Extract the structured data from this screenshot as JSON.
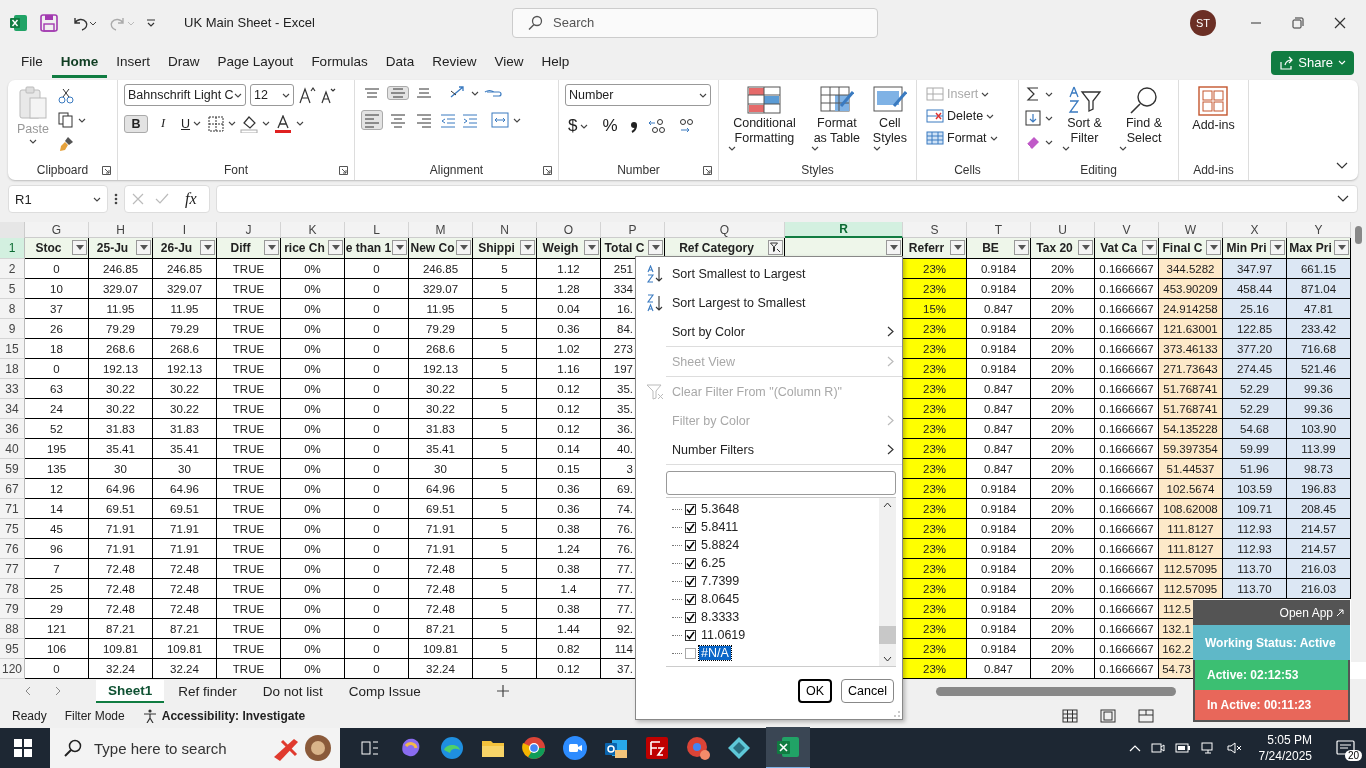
{
  "title_bar": {
    "document_title": "UK Main Sheet  -  Excel",
    "search": {
      "placeholder": "Search"
    },
    "avatar": "ST"
  },
  "menu_tabs": [
    {
      "label": "File",
      "selected": false
    },
    {
      "label": "Home",
      "selected": true
    },
    {
      "label": "Insert",
      "selected": false
    },
    {
      "label": "Draw",
      "selected": false
    },
    {
      "label": "Page Layout",
      "selected": false
    },
    {
      "label": "Formulas",
      "selected": false
    },
    {
      "label": "Data",
      "selected": false
    },
    {
      "label": "Review",
      "selected": false
    },
    {
      "label": "View",
      "selected": false
    },
    {
      "label": "Help",
      "selected": false
    }
  ],
  "share_button": "Share",
  "ribbon": {
    "clipboard": {
      "paste": "Paste",
      "label": "Clipboard"
    },
    "font": {
      "name": "Bahnschrift Light C",
      "size": "12",
      "bold": {
        "label": "B",
        "on": true
      },
      "italic": "I",
      "underline": "U",
      "label": "Font"
    },
    "alignment": {
      "vertical": [
        {
          "kind": "top",
          "on": false
        },
        {
          "kind": "middle",
          "on": true
        },
        {
          "kind": "bottom",
          "on": false
        }
      ],
      "horizontal": [
        {
          "kind": "left",
          "on": true
        },
        {
          "kind": "center",
          "on": false
        },
        {
          "kind": "right",
          "on": false
        }
      ],
      "label": "Alignment"
    },
    "number": {
      "format": "Number",
      "currency": "$",
      "percent": "%",
      "label": "Number"
    },
    "styles": {
      "buttons": [
        {
          "kind": "conditional",
          "label": "Conditional Formatting"
        },
        {
          "kind": "table",
          "label": "Format as Table"
        },
        {
          "kind": "cell",
          "label": "Cell Styles"
        }
      ],
      "label": "Styles"
    },
    "cells": {
      "buttons": [
        {
          "kind": "insert",
          "label": "Insert",
          "disabled": true
        },
        {
          "kind": "delete",
          "label": "Delete",
          "disabled": false
        },
        {
          "kind": "format",
          "label": "Format",
          "disabled": false
        }
      ],
      "label": "Cells"
    },
    "editing": {
      "buttons": [
        {
          "kind": "sort",
          "label": "Sort & Filter"
        },
        {
          "kind": "find",
          "label": "Find & Select"
        }
      ],
      "label": "Editing"
    },
    "addins": {
      "button": "Add-ins",
      "label": "Add-ins"
    }
  },
  "formula_bar": {
    "name_box": "R1",
    "fx": "fx"
  },
  "columns": [
    {
      "letter": "G",
      "selected": false
    },
    {
      "letter": "H",
      "selected": false
    },
    {
      "letter": "I",
      "selected": false
    },
    {
      "letter": "J",
      "selected": false
    },
    {
      "letter": "K",
      "selected": false
    },
    {
      "letter": "L",
      "selected": false
    },
    {
      "letter": "M",
      "selected": false
    },
    {
      "letter": "N",
      "selected": false
    },
    {
      "letter": "O",
      "selected": false
    },
    {
      "letter": "P",
      "selected": false
    },
    {
      "letter": "Q",
      "selected": false
    },
    {
      "letter": "R",
      "selected": true
    },
    {
      "letter": "S",
      "selected": false
    },
    {
      "letter": "T",
      "selected": false
    },
    {
      "letter": "U",
      "selected": false
    },
    {
      "letter": "V",
      "selected": false
    },
    {
      "letter": "W",
      "selected": false
    },
    {
      "letter": "X",
      "selected": false
    },
    {
      "letter": "Y",
      "selected": false
    }
  ],
  "header_row": {
    "number": "1",
    "cells": [
      {
        "label": "Stoc",
        "filter_active": false
      },
      {
        "label": "25-Ju",
        "filter_active": false
      },
      {
        "label": "26-Ju",
        "filter_active": false
      },
      {
        "label": "Diff",
        "filter_active": false
      },
      {
        "label": "rice Ch",
        "filter_active": false
      },
      {
        "label": "e than 1",
        "filter_active": false
      },
      {
        "label": "New Co",
        "filter_active": false
      },
      {
        "label": "Shippi",
        "filter_active": false
      },
      {
        "label": "Weigh",
        "filter_active": false
      },
      {
        "label": "Total C",
        "filter_active": false
      },
      {
        "label": "Ref Category",
        "filter_active": true
      },
      {
        "filter_active": false
      },
      {
        "label": "Referr",
        "filter_active": false
      },
      {
        "label": "BE",
        "filter_active": false
      },
      {
        "label": "Tax 20",
        "filter_active": false
      },
      {
        "label": "Vat Ca",
        "filter_active": false
      },
      {
        "label": "Final C",
        "filter_active": false
      },
      {
        "label": "Min Pri",
        "filter_active": false
      },
      {
        "label": "Max Pri",
        "filter_active": false
      }
    ]
  },
  "rows": [
    {
      "number": "2",
      "cells": [
        "0",
        "246.85",
        "246.85",
        "TRUE",
        "0%",
        "0",
        "246.85",
        "5",
        "1.12",
        "251",
        "23%",
        "0.9184",
        "20%",
        "0.1666667",
        "344.5282",
        "347.97",
        "661.15"
      ]
    },
    {
      "number": "5",
      "cells": [
        "10",
        "329.07",
        "329.07",
        "TRUE",
        "0%",
        "0",
        "329.07",
        "5",
        "1.28",
        "334",
        "23%",
        "0.9184",
        "20%",
        "0.1666667",
        "453.90209",
        "458.44",
        "871.04"
      ]
    },
    {
      "number": "8",
      "cells": [
        "37",
        "11.95",
        "11.95",
        "TRUE",
        "0%",
        "0",
        "11.95",
        "5",
        "0.04",
        "16.",
        "15%",
        "0.847",
        "20%",
        "0.1666667",
        "24.914258",
        "25.16",
        "47.81"
      ]
    },
    {
      "number": "9",
      "cells": [
        "26",
        "79.29",
        "79.29",
        "TRUE",
        "0%",
        "0",
        "79.29",
        "5",
        "0.36",
        "84.",
        "23%",
        "0.9184",
        "20%",
        "0.1666667",
        "121.63001",
        "122.85",
        "233.42"
      ]
    },
    {
      "number": "15",
      "cells": [
        "18",
        "268.6",
        "268.6",
        "TRUE",
        "0%",
        "0",
        "268.6",
        "5",
        "1.02",
        "273",
        "23%",
        "0.9184",
        "20%",
        "0.1666667",
        "373.46133",
        "377.20",
        "716.68"
      ]
    },
    {
      "number": "18",
      "cells": [
        "0",
        "192.13",
        "192.13",
        "TRUE",
        "0%",
        "0",
        "192.13",
        "5",
        "1.16",
        "197",
        "23%",
        "0.9184",
        "20%",
        "0.1666667",
        "271.73643",
        "274.45",
        "521.46"
      ]
    },
    {
      "number": "33",
      "cells": [
        "63",
        "30.22",
        "30.22",
        "TRUE",
        "0%",
        "0",
        "30.22",
        "5",
        "0.12",
        "35.",
        "23%",
        "0.847",
        "20%",
        "0.1666667",
        "51.768741",
        "52.29",
        "99.36"
      ]
    },
    {
      "number": "34",
      "cells": [
        "24",
        "30.22",
        "30.22",
        "TRUE",
        "0%",
        "0",
        "30.22",
        "5",
        "0.12",
        "35.",
        "23%",
        "0.847",
        "20%",
        "0.1666667",
        "51.768741",
        "52.29",
        "99.36"
      ]
    },
    {
      "number": "36",
      "cells": [
        "52",
        "31.83",
        "31.83",
        "TRUE",
        "0%",
        "0",
        "31.83",
        "5",
        "0.12",
        "36.",
        "23%",
        "0.847",
        "20%",
        "0.1666667",
        "54.135228",
        "54.68",
        "103.90"
      ]
    },
    {
      "number": "40",
      "cells": [
        "195",
        "35.41",
        "35.41",
        "TRUE",
        "0%",
        "0",
        "35.41",
        "5",
        "0.14",
        "40.",
        "23%",
        "0.847",
        "20%",
        "0.1666667",
        "59.397354",
        "59.99",
        "113.99"
      ]
    },
    {
      "number": "59",
      "cells": [
        "135",
        "30",
        "30",
        "TRUE",
        "0%",
        "0",
        "30",
        "5",
        "0.15",
        "3",
        "23%",
        "0.847",
        "20%",
        "0.1666667",
        "51.44537",
        "51.96",
        "98.73"
      ]
    },
    {
      "number": "67",
      "cells": [
        "12",
        "64.96",
        "64.96",
        "TRUE",
        "0%",
        "0",
        "64.96",
        "5",
        "0.36",
        "69.",
        "23%",
        "0.9184",
        "20%",
        "0.1666667",
        "102.5674",
        "103.59",
        "196.83"
      ]
    },
    {
      "number": "71",
      "cells": [
        "14",
        "69.51",
        "69.51",
        "TRUE",
        "0%",
        "0",
        "69.51",
        "5",
        "0.36",
        "74.",
        "23%",
        "0.9184",
        "20%",
        "0.1666667",
        "108.62008",
        "109.71",
        "208.45"
      ]
    },
    {
      "number": "75",
      "cells": [
        "45",
        "71.91",
        "71.91",
        "TRUE",
        "0%",
        "0",
        "71.91",
        "5",
        "0.38",
        "76.",
        "23%",
        "0.9184",
        "20%",
        "0.1666667",
        "111.8127",
        "112.93",
        "214.57"
      ]
    },
    {
      "number": "76",
      "cells": [
        "96",
        "71.91",
        "71.91",
        "TRUE",
        "0%",
        "0",
        "71.91",
        "5",
        "1.24",
        "76.",
        "23%",
        "0.9184",
        "20%",
        "0.1666667",
        "111.8127",
        "112.93",
        "214.57"
      ]
    },
    {
      "number": "77",
      "cells": [
        "7",
        "72.48",
        "72.48",
        "TRUE",
        "0%",
        "0",
        "72.48",
        "5",
        "0.38",
        "77.",
        "23%",
        "0.9184",
        "20%",
        "0.1666667",
        "112.57095",
        "113.70",
        "216.03"
      ]
    },
    {
      "number": "78",
      "cells": [
        "25",
        "72.48",
        "72.48",
        "TRUE",
        "0%",
        "0",
        "72.48",
        "5",
        "1.4",
        "77.",
        "23%",
        "0.9184",
        "20%",
        "0.1666667",
        "112.57095",
        "113.70",
        "216.03"
      ]
    },
    {
      "number": "79",
      "cells": [
        "29",
        "72.48",
        "72.48",
        "TRUE",
        "0%",
        "0",
        "72.48",
        "5",
        "0.38",
        "77.",
        "23%",
        "0.9184",
        "20%",
        "0.1666667",
        "112.5"
      ]
    },
    {
      "number": "88",
      "cells": [
        "121",
        "87.21",
        "87.21",
        "TRUE",
        "0%",
        "0",
        "87.21",
        "5",
        "1.44",
        "92.",
        "23%",
        "0.9184",
        "20%",
        "0.1666667",
        "132.1"
      ]
    },
    {
      "number": "95",
      "cells": [
        "106",
        "109.81",
        "109.81",
        "TRUE",
        "0%",
        "0",
        "109.81",
        "5",
        "0.82",
        "114",
        "23%",
        "0.9184",
        "20%",
        "0.1666667",
        "162.2"
      ]
    },
    {
      "number": "120",
      "cells": [
        "0",
        "32.24",
        "32.24",
        "TRUE",
        "0%",
        "0",
        "32.24",
        "5",
        "0.12",
        "37.",
        "23%",
        "0.847",
        "20%",
        "0.1666667",
        "54.73"
      ]
    }
  ],
  "filter_menu": {
    "items": [
      {
        "kind": "sort-asc",
        "label": "Sort Smallest to Largest",
        "disabled": false
      },
      {
        "kind": "sort-desc",
        "label": "Sort Largest to Smallest",
        "disabled": false
      },
      {
        "kind": "submenu",
        "label": "Sort by Color",
        "disabled": false
      },
      {
        "kind": "submenu",
        "label": "Sheet View",
        "disabled": true
      },
      {
        "kind": "clear",
        "label": "Clear Filter From \"(Column R)\"",
        "disabled": true
      },
      {
        "kind": "submenu",
        "label": "Filter by Color",
        "disabled": true
      },
      {
        "kind": "submenu",
        "label": "Number Filters",
        "disabled": false
      }
    ],
    "values": [
      {
        "label": "5.3648",
        "checked": true,
        "selected": false
      },
      {
        "label": "5.8411",
        "checked": true,
        "selected": false
      },
      {
        "label": "5.8824",
        "checked": true,
        "selected": false
      },
      {
        "label": "6.25",
        "checked": true,
        "selected": false
      },
      {
        "label": "7.7399",
        "checked": true,
        "selected": false
      },
      {
        "label": "8.0645",
        "checked": true,
        "selected": false
      },
      {
        "label": "8.3333",
        "checked": true,
        "selected": false
      },
      {
        "label": "11.0619",
        "checked": true,
        "selected": false
      },
      {
        "label": "#N/A",
        "checked": false,
        "selected": true
      }
    ],
    "ok": "OK",
    "cancel": "Cancel"
  },
  "sheet_tabs": [
    {
      "label": "Sheet1",
      "selected": true
    },
    {
      "label": "Ref finder",
      "selected": false
    },
    {
      "label": "Do not list",
      "selected": false
    },
    {
      "label": "Comp Issue",
      "selected": false
    }
  ],
  "status_bar": {
    "mode": "Ready",
    "filter": "Filter Mode",
    "accessibility": "Accessibility: Investigate"
  },
  "tracker": {
    "open_app": "Open App",
    "status": "Working Status: Active",
    "active": "Active: 02:12:53",
    "inactive": "In Active: 00:11:23"
  },
  "taskbar": {
    "search_placeholder": "Type here to search",
    "time": "5:05 PM",
    "date": "7/24/2025",
    "notifications": "20"
  }
}
